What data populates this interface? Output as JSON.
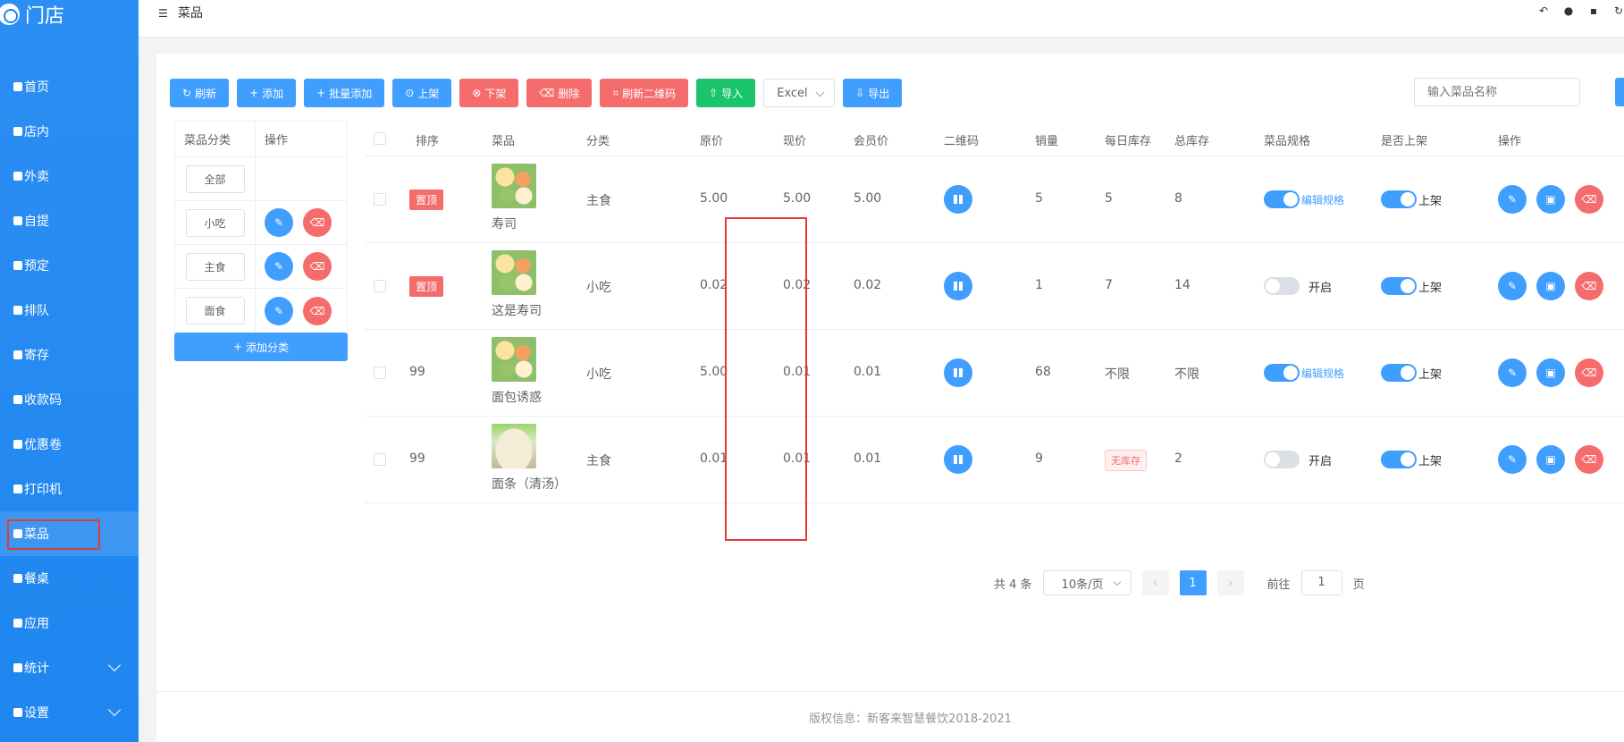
{
  "sidebar": {
    "title": "门店",
    "items": [
      {
        "label": "首页",
        "icon": "home-icon"
      },
      {
        "label": "店内",
        "icon": "person-icon"
      },
      {
        "label": "外卖",
        "icon": "delivery-icon"
      },
      {
        "label": "自提",
        "icon": "bag-icon"
      },
      {
        "label": "预定",
        "icon": "reserve-icon"
      },
      {
        "label": "排队",
        "icon": "queue-icon"
      },
      {
        "label": "寄存",
        "icon": "storage-icon"
      },
      {
        "label": "收款码",
        "icon": "qrcode-icon"
      },
      {
        "label": "优惠卷",
        "icon": "coupon-icon"
      },
      {
        "label": "打印机",
        "icon": "printer-icon"
      },
      {
        "label": "菜品",
        "icon": "dish-icon",
        "active": true
      },
      {
        "label": "餐桌",
        "icon": "table-icon"
      },
      {
        "label": "应用",
        "icon": "app-icon"
      },
      {
        "label": "统计",
        "icon": "stats-icon",
        "expandable": true
      },
      {
        "label": "设置",
        "icon": "settings-icon",
        "expandable": true
      }
    ]
  },
  "topbar": {
    "menu_icon": "☰",
    "title": "菜品"
  },
  "toolbar": {
    "refresh": "刷新",
    "add": "添加",
    "batch_add": "批量添加",
    "on_shelf": "上架",
    "off_shelf": "下架",
    "delete": "删除",
    "refresh_qr": "刷新二维码",
    "import": "导入",
    "format_select": "Excel",
    "export": "导出",
    "search_placeholder": "输入菜品名称"
  },
  "categories": {
    "headers": [
      "菜品分类",
      "操作"
    ],
    "rows": [
      {
        "name": "全部",
        "editable": false
      },
      {
        "name": "小吃",
        "editable": true
      },
      {
        "name": "主食",
        "editable": true
      },
      {
        "name": "面食",
        "editable": true
      }
    ],
    "add_label": "添加分类"
  },
  "dishes": {
    "headers": [
      "排序",
      "菜品",
      "分类",
      "原价",
      "现价",
      "会员价",
      "二维码",
      "销量",
      "每日库存",
      "总库存",
      "菜品规格",
      "是否上架",
      "操作"
    ],
    "rows": [
      {
        "sort": "置顶",
        "sort_is_tag": true,
        "name": "寿司",
        "category": "主食",
        "orig": "5.00",
        "now": "5.00",
        "member": "5.00",
        "sales": "5",
        "daily": "5",
        "daily_is_tag": false,
        "total": "8",
        "spec_on": true,
        "spec_text": "编辑规格",
        "shelf_on": true,
        "shelf_text": "上架"
      },
      {
        "sort": "置顶",
        "sort_is_tag": true,
        "name": "这是寿司",
        "category": "小吃",
        "orig": "0.02",
        "now": "0.02",
        "member": "0.02",
        "sales": "1",
        "daily": "7",
        "daily_is_tag": false,
        "total": "14",
        "spec_on": false,
        "spec_text": "开启",
        "shelf_on": true,
        "shelf_text": "上架"
      },
      {
        "sort": "99",
        "sort_is_tag": false,
        "name": "面包诱惑",
        "category": "小吃",
        "orig": "5.00",
        "now": "0.01",
        "member": "0.01",
        "sales": "68",
        "daily": "不限",
        "daily_is_tag": false,
        "total": "不限",
        "spec_on": true,
        "spec_text": "编辑规格",
        "shelf_on": true,
        "shelf_text": "上架"
      },
      {
        "sort": "99",
        "sort_is_tag": false,
        "name": "面条（清汤）",
        "category": "主食",
        "orig": "0.01",
        "now": "0.01",
        "member": "0.01",
        "sales": "9",
        "daily": "无库存",
        "daily_is_tag": true,
        "total": "2",
        "spec_on": false,
        "spec_text": "开启",
        "shelf_on": true,
        "shelf_text": "上架"
      }
    ]
  },
  "pagination": {
    "total": "共 4 条",
    "page_size": "10条/页",
    "current": "1",
    "goto_label": "前往",
    "goto_value": "1",
    "page_suffix": "页"
  },
  "footer": "版权信息：新客来智慧餐饮2018-2021",
  "colors": {
    "primary": "#409eff",
    "danger": "#f56c6c",
    "success": "#19c46a",
    "sidebar": "#1f86f0",
    "highlight": "#e53935"
  }
}
